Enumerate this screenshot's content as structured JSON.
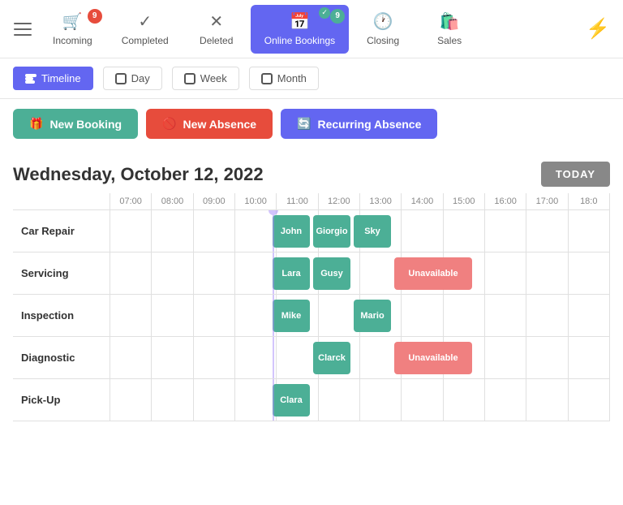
{
  "nav": {
    "tabs": [
      {
        "id": "incoming",
        "label": "Incoming",
        "icon": "🛒",
        "badge": "9",
        "badgeColor": "red",
        "active": false
      },
      {
        "id": "completed",
        "label": "Completed",
        "icon": "✓",
        "badge": null,
        "active": false
      },
      {
        "id": "deleted",
        "label": "Deleted",
        "icon": "✕",
        "badge": null,
        "active": false
      },
      {
        "id": "online-bookings",
        "label": "Online Bookings",
        "icon": "📅",
        "badge": "9",
        "badgeColor": "green",
        "checkBadge": true,
        "active": true
      },
      {
        "id": "closing",
        "label": "Closing",
        "icon": "🕐",
        "badge": null,
        "active": false
      },
      {
        "id": "sales",
        "label": "Sales",
        "icon": "🛍️",
        "badge": null,
        "active": false
      }
    ]
  },
  "toolbar": {
    "views": [
      {
        "id": "timeline",
        "label": "Timeline",
        "active": true
      },
      {
        "id": "day",
        "label": "Day",
        "active": false
      },
      {
        "id": "week",
        "label": "Week",
        "active": false
      },
      {
        "id": "month",
        "label": "Month",
        "active": false
      }
    ]
  },
  "actions": {
    "new_booking_label": "New Booking",
    "new_absence_label": "New Absence",
    "recurring_absence_label": "Recurring Absence"
  },
  "calendar": {
    "date_label": "October 12, 2022",
    "day_label": "Wednesday,",
    "today_button": "TODAY",
    "time_slots": [
      "07:00",
      "08:00",
      "09:00",
      "10:00",
      "11:00",
      "12:00",
      "13:00",
      "14:00",
      "15:00",
      "16:00",
      "17:00",
      "18:0"
    ],
    "rows": [
      {
        "label": "Car Repair",
        "blocks": [
          {
            "name": "John",
            "start": 4,
            "width": 1,
            "color": "green"
          },
          {
            "name": "Giorgio",
            "start": 5,
            "width": 1,
            "color": "green"
          },
          {
            "name": "Sky",
            "start": 6,
            "width": 1,
            "color": "green"
          }
        ]
      },
      {
        "label": "Servicing",
        "blocks": [
          {
            "name": "Lara",
            "start": 4,
            "width": 1,
            "color": "green"
          },
          {
            "name": "Gusy",
            "start": 5,
            "width": 1,
            "color": "green"
          },
          {
            "name": "Unavailable",
            "start": 7,
            "width": 2,
            "color": "red"
          }
        ]
      },
      {
        "label": "Inspection",
        "blocks": [
          {
            "name": "Mike",
            "start": 4,
            "width": 1,
            "color": "green"
          },
          {
            "name": "Mario",
            "start": 6,
            "width": 1,
            "color": "green"
          }
        ]
      },
      {
        "label": "Diagnostic",
        "blocks": [
          {
            "name": "Clarck",
            "start": 5,
            "width": 1,
            "color": "green"
          },
          {
            "name": "Unavailable",
            "start": 7,
            "width": 2,
            "color": "red"
          }
        ]
      },
      {
        "label": "Pick-Up",
        "blocks": [
          {
            "name": "Clara",
            "start": 4,
            "width": 1,
            "color": "green"
          }
        ]
      }
    ]
  }
}
